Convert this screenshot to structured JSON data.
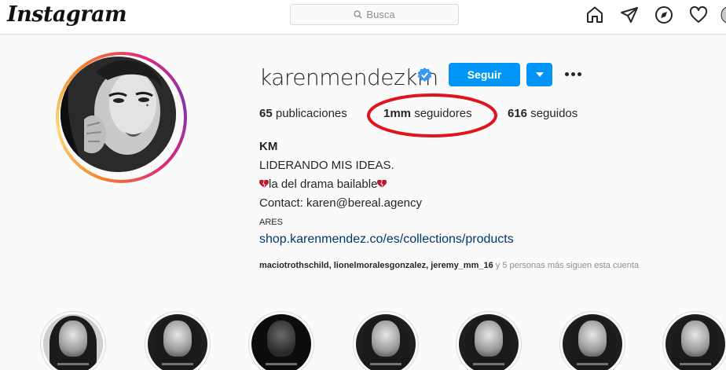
{
  "topbar": {
    "logo_text": "Instagram",
    "search_placeholder": "Busca",
    "icons": [
      "home-icon",
      "direct-icon",
      "explore-icon",
      "activity-icon",
      "profile-icon"
    ]
  },
  "profile": {
    "username": "karenmendezkm",
    "verified": true,
    "follow_label": "Seguir",
    "stats": {
      "posts_count": "65",
      "posts_label": "publicaciones",
      "followers_count": "1mm",
      "followers_label": "seguidores",
      "following_count": "616",
      "following_label": "seguidos"
    },
    "bio": {
      "name": "KM",
      "line1": "LIDERANDO MIS IDEAS.",
      "line2": "la del drama bailable",
      "line3": "Contact: karen@bereal.agency",
      "category": "ARES",
      "link": "shop.karenmendez.co/es/collections/products"
    },
    "followed_by": {
      "names": "maciotrothschild, lionelmoralesgonzalez, jeremy_mm_16",
      "rest": " y 5 personas más siguen esta cuenta"
    }
  },
  "highlights_count": 7,
  "colors": {
    "accent": "#0095f6",
    "link": "#00376b",
    "annotation_circle": "#e0141b"
  }
}
